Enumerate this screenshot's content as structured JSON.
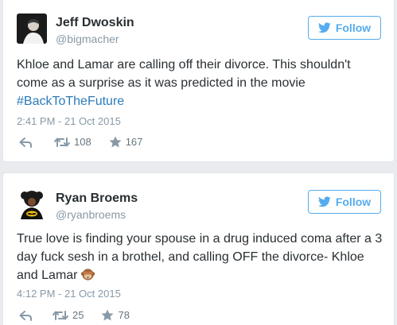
{
  "tweets": [
    {
      "name": "Jeff Dwoskin",
      "handle": "@bigmacher",
      "follow_label": "Follow",
      "text": "Khloe and Lamar are calling off their divorce. This shouldn't come as a surprise as it was predicted in the movie ",
      "hashtag": "#BackToTheFuture",
      "timestamp": "2:41 PM - 21 Oct 2015",
      "retweets": "108",
      "likes": "167"
    },
    {
      "name": "Ryan Broems",
      "handle": "@ryanbroems",
      "follow_label": "Follow",
      "text": "True love is finding your spouse in a drug induced coma after a 3 day fuck sesh in a brothel, and calling OFF the divorce- Khloe and Lamar ",
      "emoji": "see-no-evil-monkey",
      "timestamp": "4:12 PM - 21 Oct 2015",
      "retweets": "25",
      "likes": "78"
    }
  ],
  "colors": {
    "accent": "#55acee",
    "hashtag": "#2b7bb9",
    "muted": "#8899a6"
  }
}
